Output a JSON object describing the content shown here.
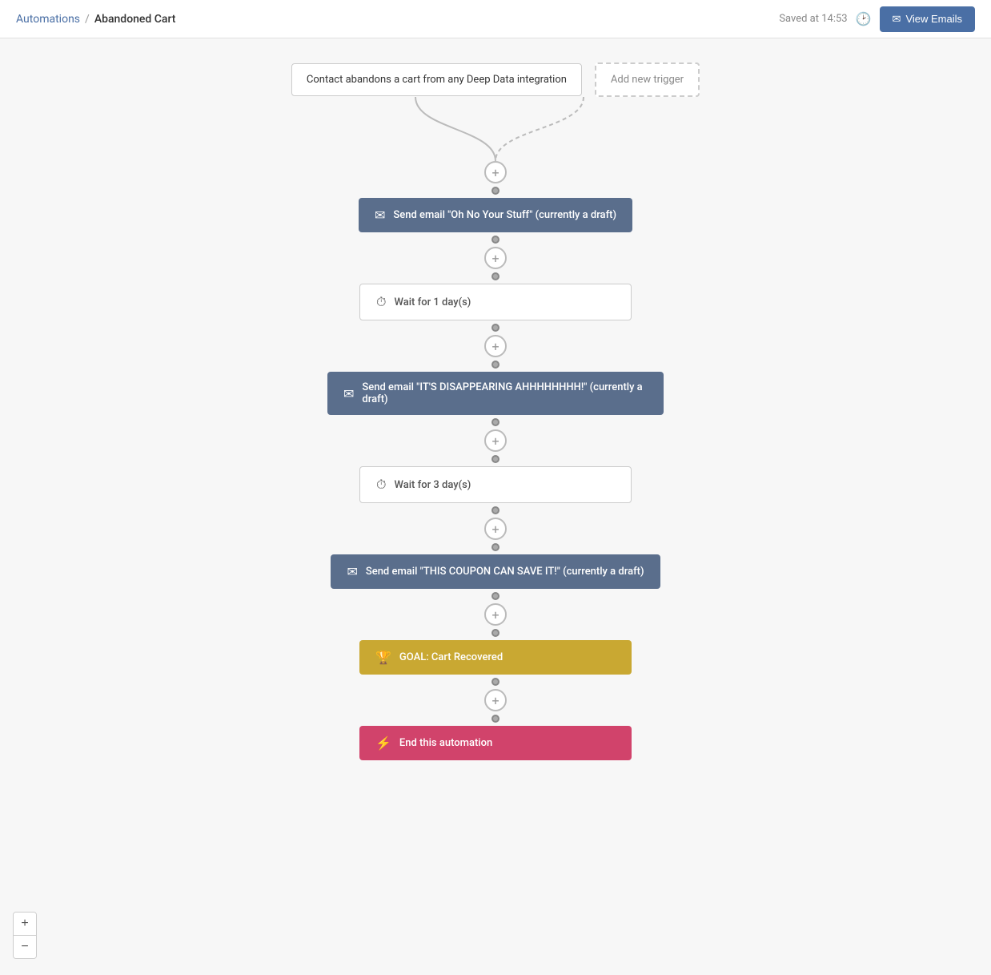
{
  "header": {
    "breadcrumb_link": "Automations",
    "breadcrumb_sep": "/",
    "breadcrumb_current": "Abandoned Cart",
    "saved_text": "Saved at 14:53",
    "view_emails_label": "View Emails"
  },
  "triggers": {
    "primary": "Contact abandons a cart from any Deep Data integration",
    "secondary": "Add new trigger"
  },
  "steps": [
    {
      "type": "email",
      "label": "Send email \"Oh No Your Stuff\" (currently a draft)"
    },
    {
      "type": "wait",
      "label": "Wait for 1 day(s)"
    },
    {
      "type": "email",
      "label": "Send email \"IT'S DISAPPEARING AHHHHHHHH!\" (currently a draft)"
    },
    {
      "type": "wait",
      "label": "Wait for 3 day(s)"
    },
    {
      "type": "email",
      "label": "Send email \"THIS COUPON CAN SAVE IT!\" (currently a draft)"
    },
    {
      "type": "goal",
      "label": "GOAL: Cart Recovered"
    },
    {
      "type": "end",
      "label": "End this automation"
    }
  ],
  "zoom": {
    "plus": "+",
    "minus": "−"
  }
}
